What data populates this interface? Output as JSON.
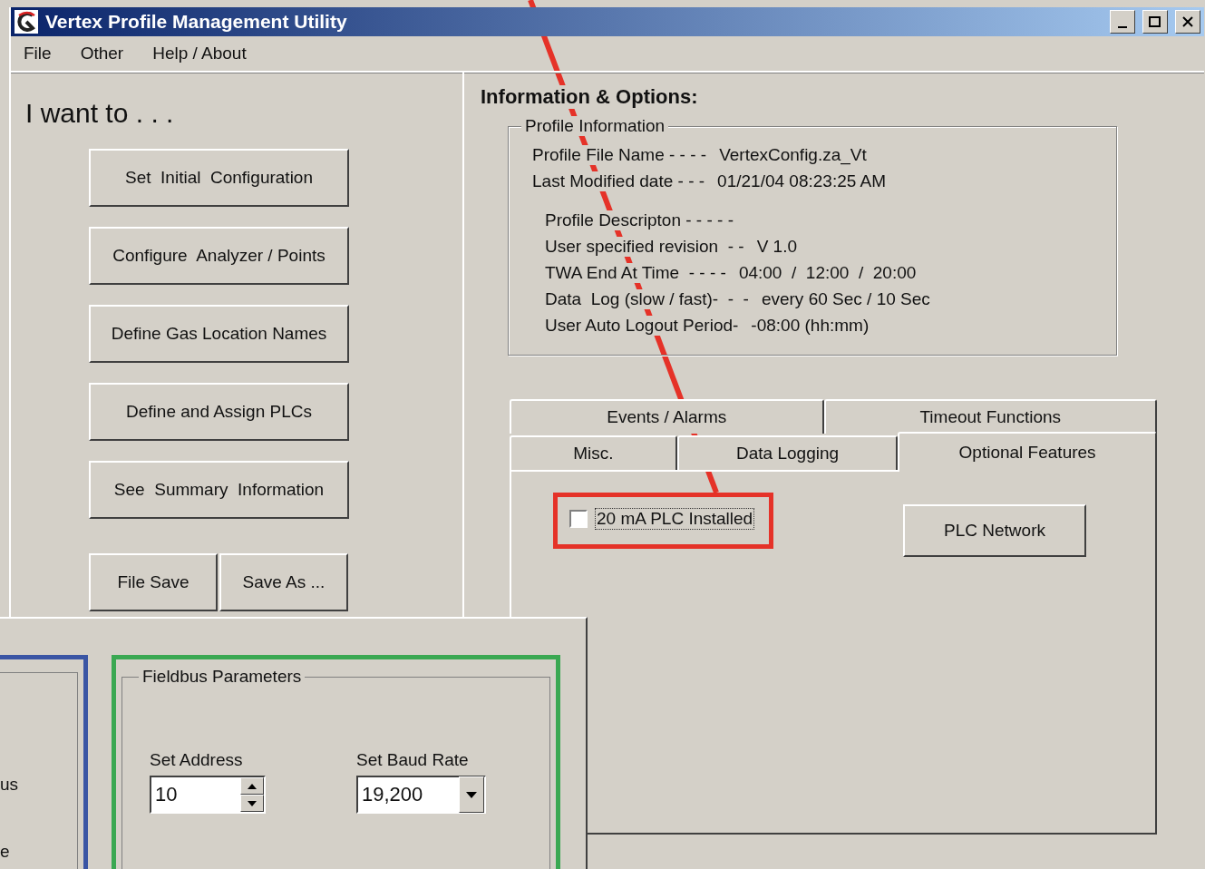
{
  "window": {
    "title": "Vertex Profile Management Utility"
  },
  "menu": [
    "File",
    "Other",
    "Help / About"
  ],
  "actions": {
    "heading": "I want to . . .",
    "buttons": [
      "Set  Initial  Configuration",
      "Configure  Analyzer / Points",
      "Define Gas Location Names",
      "Define and Assign PLCs",
      "See  Summary  Information"
    ],
    "file_buttons": [
      "File Save",
      "Save As ..."
    ]
  },
  "info": {
    "heading": "Information & Options:",
    "group_title": "Profile Information",
    "file_rows": [
      {
        "label": "Profile File Name - - - -",
        "value": "VertexConfig.za_Vt"
      },
      {
        "label": "Last Modified date - - -",
        "value": "01/21/04 08:23:25 AM"
      }
    ],
    "profile_rows": [
      {
        "label": "Profile Descripton - - - - -"
      },
      {
        "label": "User specified revision  - -",
        "value": "V 1.0"
      },
      {
        "label": "TWA End At Time  - - - -",
        "value": "04:00  /  12:00  /  20:00"
      },
      {
        "label": "Data  Log (slow / fast)-  -  -",
        "value": "every 60 Sec / 10 Sec"
      },
      {
        "label": "User Auto Logout Period-",
        "value": "-08:00 (hh:mm)"
      }
    ]
  },
  "tab_rows": [
    {
      "tabs": [
        {
          "label": "Events / Alarms",
          "selected": false
        },
        {
          "label": "Timeout Functions",
          "selected": false
        }
      ]
    },
    {
      "tabs": [
        {
          "label": "Misc.",
          "selected": false
        },
        {
          "label": "Data Logging",
          "selected": false
        },
        {
          "label": "Optional Features",
          "selected": true
        }
      ]
    }
  ],
  "options": {
    "checkbox": {
      "label": "20 mA PLC Installed",
      "checked": false
    },
    "button": "PLC Network"
  },
  "dialog": {
    "left_group_fragments": [
      "us",
      "e"
    ],
    "fieldbus": {
      "title": "Fieldbus Parameters",
      "address": {
        "label": "Set Address",
        "value": "10"
      },
      "baud_rate": {
        "label": "Set Baud Rate",
        "value": "19,200"
      }
    }
  },
  "annotations": [
    {
      "kind": "arrow-line",
      "color": "#e53228"
    },
    {
      "kind": "frame",
      "color": "#e53228"
    },
    {
      "kind": "frame",
      "color": "#3a55a4"
    },
    {
      "kind": "frame",
      "color": "#3aa852"
    }
  ]
}
